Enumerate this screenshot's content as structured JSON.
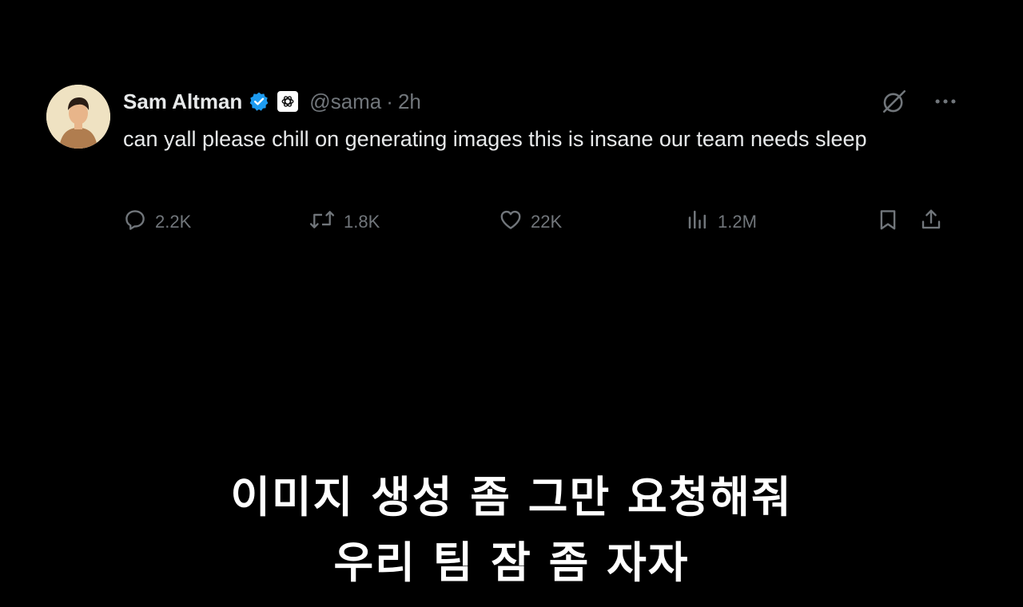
{
  "tweet": {
    "author_name": "Sam Altman",
    "handle": "@sama",
    "separator": "·",
    "time": "2h",
    "text": "can yall please chill on generating images this is insane our team needs sleep",
    "stats": {
      "replies": "2.2K",
      "retweets": "1.8K",
      "likes": "22K",
      "views": "1.2M"
    },
    "icons": {
      "verified": "verified-badge-icon",
      "org_badge": "openai-logo-icon",
      "grok": "grok-icon",
      "more": "more-icon",
      "reply": "reply-icon",
      "retweet": "retweet-icon",
      "like": "heart-icon",
      "views": "views-icon",
      "bookmark": "bookmark-icon",
      "share": "share-icon"
    }
  },
  "subtitle": {
    "line1": "이미지 생성 좀 그만 요청해줘",
    "line2": "우리 팀 잠 좀 자자"
  },
  "colors": {
    "background": "#000000",
    "primary_text": "#e7e9ea",
    "secondary_text": "#71767b",
    "verified_blue": "#1d9bf0",
    "subtitle_text": "#ffffff"
  }
}
